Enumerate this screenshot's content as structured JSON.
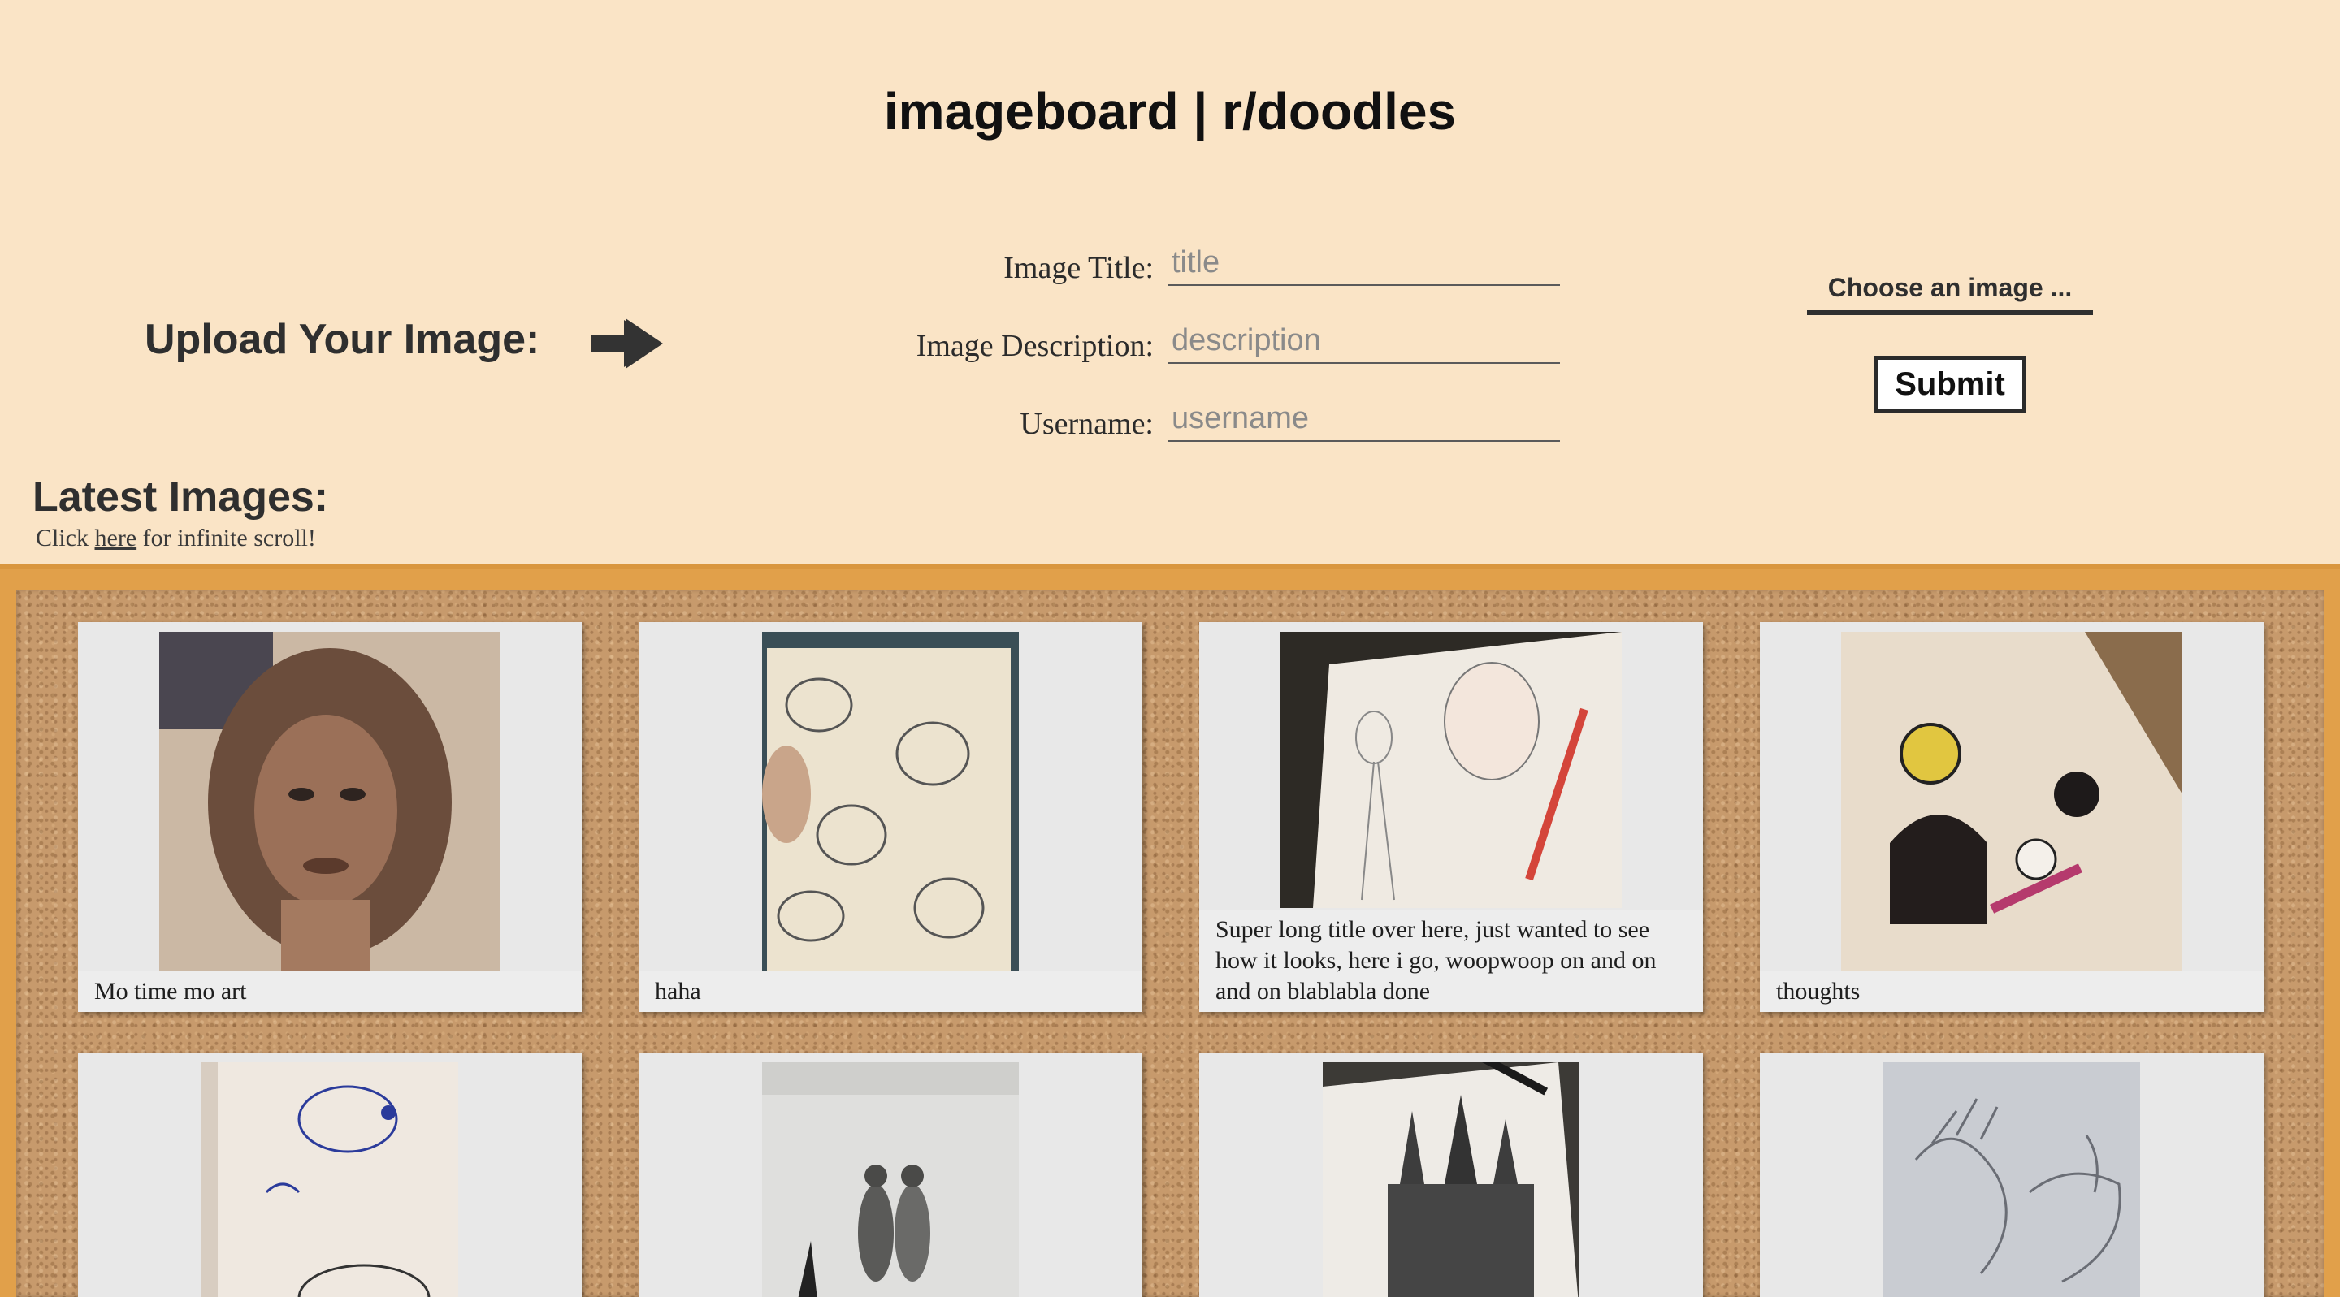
{
  "header": {
    "title": "imageboard | r/doodles"
  },
  "upload": {
    "heading": "Upload Your Image:",
    "fields": [
      {
        "label": "Image Title:",
        "placeholder": "title"
      },
      {
        "label": "Image Description:",
        "placeholder": "description"
      },
      {
        "label": "Username:",
        "placeholder": "username"
      }
    ],
    "choose_label": "Choose an image ...",
    "submit_label": "Submit"
  },
  "latest": {
    "heading": "Latest Images:",
    "note_prefix": "Click ",
    "note_link": "here",
    "note_suffix": " for infinite scroll!"
  },
  "cards": [
    {
      "title": "Mo time mo art",
      "icon": "portrait-drawing-image"
    },
    {
      "title": "haha",
      "icon": "raccoon-sketch-image"
    },
    {
      "title": "Super long title over here, just wanted to see how it looks, here i go, woopwoop on and on and on blablabla done",
      "icon": "figure-sketch-image"
    },
    {
      "title": "thoughts",
      "icon": "sticker-doodles-image"
    },
    {
      "title": "",
      "icon": "blue-ink-doodle-image"
    },
    {
      "title": "",
      "icon": "couple-sketch-image"
    },
    {
      "title": "",
      "icon": "castle-drawing-image"
    },
    {
      "title": "",
      "icon": "hands-sketch-image"
    }
  ],
  "colors": {
    "background": "#fae4c6",
    "board_frame": "#e1a04a",
    "cork": "#c79a6c",
    "card": "#e8e8e8"
  }
}
